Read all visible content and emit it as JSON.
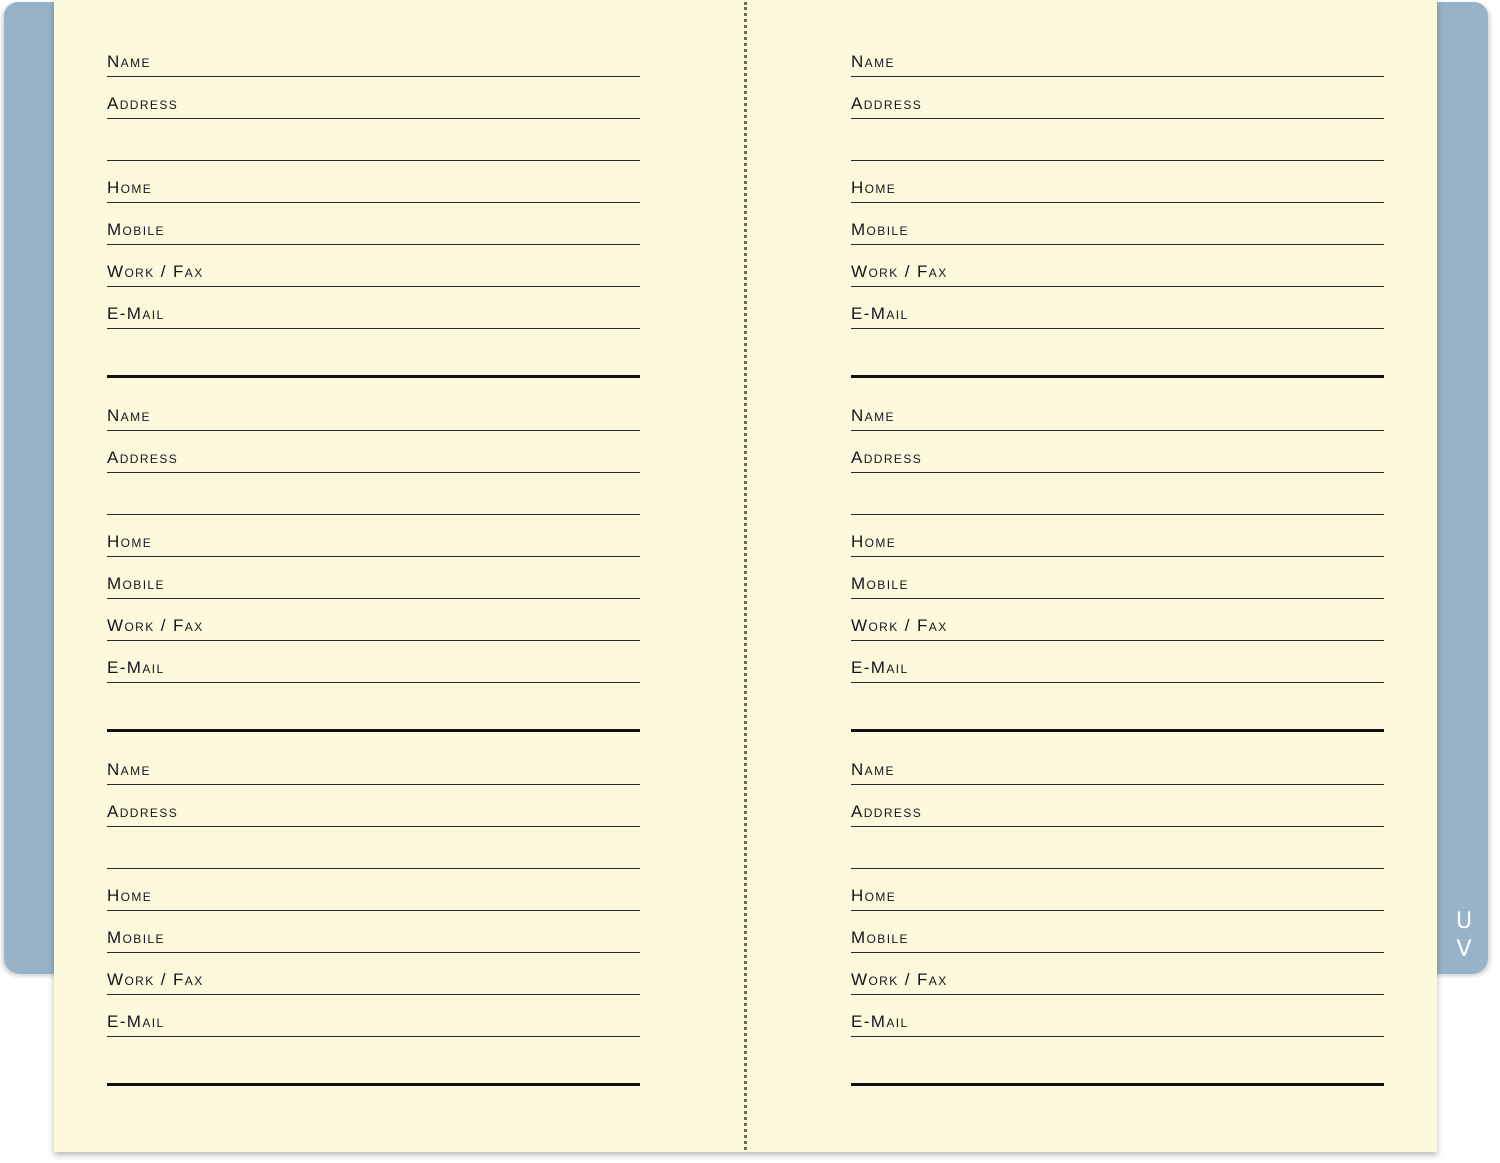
{
  "labels": {
    "name": "Name",
    "address": "Address",
    "home": "Home",
    "mobile": "Mobile",
    "work_fax": "Work / Fax",
    "email": "E-Mail"
  },
  "tab": {
    "letters": [
      "U",
      "V"
    ]
  },
  "colors": {
    "cover": "#97b3c9",
    "paper": "#fdf9dc",
    "ink": "#15151c"
  }
}
